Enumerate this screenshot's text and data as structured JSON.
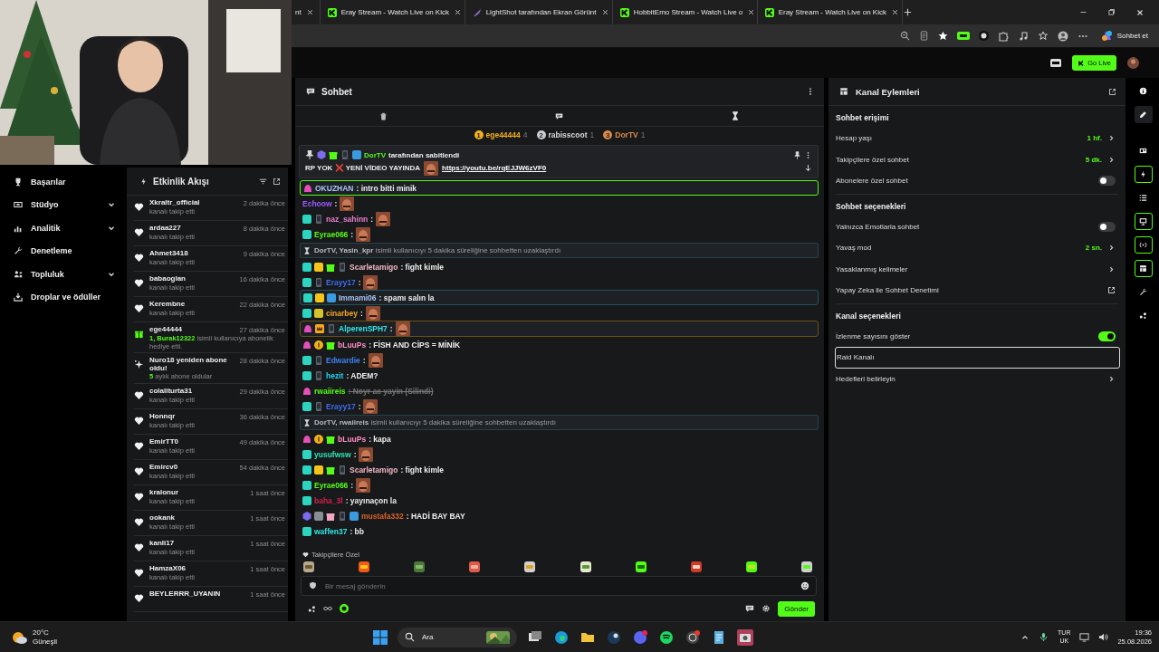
{
  "browser": {
    "tabs": [
      {
        "title": "nt"
      },
      {
        "title": "Eray Stream - Watch Live on Kick"
      },
      {
        "title": "LightShot tarafından Ekran Görünt"
      },
      {
        "title": "HobbitEmo Stream - Watch Live o"
      },
      {
        "title": "Eray Stream - Watch Live on Kick"
      }
    ],
    "copilot_label": "Sohbet et"
  },
  "header": {
    "go_live": "Go Live"
  },
  "sidebar": {
    "items": [
      {
        "label": "Başarılar",
        "expandable": false
      },
      {
        "label": "Stüdyo",
        "expandable": true
      },
      {
        "label": "Analitik",
        "expandable": true
      },
      {
        "label": "Denetleme",
        "expandable": false
      },
      {
        "label": "Topluluk",
        "expandable": true
      },
      {
        "label": "Droplar ve ödüller",
        "expandable": false
      }
    ]
  },
  "activity_feed": {
    "title": "Etkinlik Akışı",
    "items": [
      {
        "kind": "follow",
        "user": "Xkraltr_official",
        "time": "2 dakika önce",
        "detail": "kanalı takip etti"
      },
      {
        "kind": "follow",
        "user": "ardaa227",
        "time": "8 dakika önce",
        "detail": "kanalı takip etti"
      },
      {
        "kind": "follow",
        "user": "Ahmet3418",
        "time": "9 dakika önce",
        "detail": "kanalı takip etti"
      },
      {
        "kind": "follow",
        "user": "babaoglan",
        "time": "16 dakika önce",
        "detail": "kanalı takip etti"
      },
      {
        "kind": "follow",
        "user": "Kerembne",
        "time": "22 dakika önce",
        "detail": "kanalı takip etti"
      },
      {
        "kind": "gift",
        "user": "ege44444",
        "time": "27 dakika önce",
        "detail": "**1, Burak12322** isimli kullanıcıya abonelik hediye etti."
      },
      {
        "kind": "resub",
        "user": "Nuro18 yeniden abone oldu!",
        "time": "28 dakika önce",
        "detail": "**5** aylık abone oldular"
      },
      {
        "kind": "follow",
        "user": "colaliturta31",
        "time": "29 dakika önce",
        "detail": "kanalı takip etti"
      },
      {
        "kind": "follow",
        "user": "Honnqr",
        "time": "36 dakika önce",
        "detail": "kanalı takip etti"
      },
      {
        "kind": "follow",
        "user": "EmirTT0",
        "time": "49 dakika önce",
        "detail": "kanalı takip etti"
      },
      {
        "kind": "follow",
        "user": "Emircv0",
        "time": "54 dakika önce",
        "detail": "kanalı takip etti"
      },
      {
        "kind": "follow",
        "user": "kralonur",
        "time": "1 saat önce",
        "detail": "kanalı takip etti"
      },
      {
        "kind": "follow",
        "user": "ookank",
        "time": "1 saat önce",
        "detail": "kanalı takip etti"
      },
      {
        "kind": "follow",
        "user": "kanli17",
        "time": "1 saat önce",
        "detail": "kanalı takip etti"
      },
      {
        "kind": "follow",
        "user": "HamzaX06",
        "time": "1 saat önce",
        "detail": "kanalı takip etti"
      },
      {
        "kind": "follow",
        "user": "BEYLERRR_UYANIN",
        "time": "1 saat önce"
      }
    ]
  },
  "chat": {
    "title": "Sohbet",
    "leaderboard": [
      {
        "rank": "1",
        "user": "ege44444",
        "count": "4"
      },
      {
        "rank": "2",
        "user": "rabisscoot",
        "count": "1"
      },
      {
        "rank": "3",
        "user": "DorTV",
        "count": "1"
      }
    ],
    "pinned": {
      "badges": [
        {
          "kind": "pin"
        },
        {
          "kind": "purple"
        },
        {
          "kind": "gift"
        },
        {
          "kind": "phone"
        },
        {
          "kind": "mod"
        }
      ],
      "user": "DorTV",
      "note": "tarafından sabitlendi",
      "text": "RP YOK ❌ YENİ VİDEO YAYINDA",
      "link": "https://youtu.be/rqEJJW6zVF0"
    },
    "messages": [
      {
        "kind": "chat",
        "badges": [
          {
            "kind": "og"
          }
        ],
        "user": "OKUZHAN",
        "color": "#a9c4f5",
        "text": ": intro bitti minik",
        "emote": false,
        "highlight": {
          "color": "#53fc18"
        },
        "deleted": false
      },
      {
        "kind": "chat",
        "user": "Echoow",
        "color": "#9b5cff",
        "text": ":",
        "emote": true,
        "deleted": false
      },
      {
        "kind": "chat",
        "badges": [
          {
            "kind": "sub"
          },
          {
            "kind": "phone"
          }
        ],
        "user": "naz_sahinn",
        "color": "#e87fcf",
        "text": ":",
        "emote": true,
        "deleted": false
      },
      {
        "kind": "chat",
        "badges": [
          {
            "kind": "sub"
          }
        ],
        "user": "Eyrae066",
        "color": "#53fc18",
        "text": ":",
        "emote": true,
        "deleted": false
      },
      {
        "kind": "system",
        "text": "**DorTV, Yasin_kpr** isimli kullanıcıyı 5 dakika süreliğine sohbetten uzaklaştırdı"
      },
      {
        "kind": "chat",
        "badges": [
          {
            "kind": "sub"
          },
          {
            "kind": "kick"
          },
          {
            "kind": "gift"
          },
          {
            "kind": "phone"
          }
        ],
        "user": "Scarletamigo",
        "color": "#f2b8c6",
        "text": ": fight kimle",
        "emote": false,
        "deleted": false
      },
      {
        "kind": "chat",
        "badges": [
          {
            "kind": "sub"
          },
          {
            "kind": "phone"
          }
        ],
        "user": "Erayy17",
        "color": "#3d6df2",
        "text": ":",
        "emote": true,
        "deleted": false
      },
      {
        "kind": "chat",
        "badges": [
          {
            "kind": "sub"
          },
          {
            "kind": "kick"
          },
          {
            "kind": "mod"
          }
        ],
        "user": "Immami06",
        "color": "#a9c4f5",
        "text": ": spamı salın la",
        "emote": false,
        "highlight": {
          "color": "#1f5560"
        },
        "deleted": false
      },
      {
        "kind": "chat",
        "badges": [
          {
            "kind": "sub"
          },
          {
            "kind": "gem"
          }
        ],
        "user": "cinarbey",
        "color": "#f5a623",
        "text": ":",
        "emote": true,
        "deleted": false
      },
      {
        "kind": "chat",
        "badges": [
          {
            "kind": "og"
          },
          {
            "kind": "crown"
          },
          {
            "kind": "phone"
          }
        ],
        "user": "AlperenSPH7",
        "color": "#2ee6e6",
        "text": ":",
        "emote": true,
        "highlight": {
          "color": "#6b5014"
        },
        "deleted": false
      },
      {
        "kind": "chat",
        "badges": [
          {
            "kind": "og"
          },
          {
            "kind": "coin"
          },
          {
            "kind": "gift"
          }
        ],
        "user": "bLuuPs",
        "color": "#ff8fc4",
        "text": ": FİSH AND CİPS = MİNİK",
        "emote": false,
        "deleted": false
      },
      {
        "kind": "chat",
        "badges": [
          {
            "kind": "sub"
          },
          {
            "kind": "phone"
          }
        ],
        "user": "Edwardie",
        "color": "#3b82f6",
        "text": ":",
        "emote": true,
        "deleted": false
      },
      {
        "kind": "chat",
        "badges": [
          {
            "kind": "sub"
          },
          {
            "kind": "phone"
          }
        ],
        "user": "hezit",
        "color": "#22d3ee",
        "text": ": ADEM?",
        "emote": false,
        "deleted": false
      },
      {
        "kind": "chat",
        "badges": [
          {
            "kind": "og"
          }
        ],
        "user": "rwaiireis",
        "color": "#53fc18",
        "text": ": Noyr ac yayin (Silindi)",
        "emote": false,
        "deleted": true
      },
      {
        "kind": "chat",
        "badges": [
          {
            "kind": "sub"
          },
          {
            "kind": "phone"
          }
        ],
        "user": "Erayy17",
        "color": "#3d6df2",
        "text": ":",
        "emote": true,
        "deleted": false
      },
      {
        "kind": "system",
        "text": "**DorTV, rwaiireis** isimli kullanıcıyı 5 dakika süreliğine sohbetten uzaklaştırdı"
      },
      {
        "kind": "chat",
        "badges": [
          {
            "kind": "og"
          },
          {
            "kind": "coin"
          },
          {
            "kind": "gift"
          }
        ],
        "user": "bLuuPs",
        "color": "#ff8fc4",
        "text": ": kapa",
        "emote": false,
        "deleted": false
      },
      {
        "kind": "chat",
        "badges": [
          {
            "kind": "sub"
          }
        ],
        "user": "yusufwsw",
        "color": "#2ee6b0",
        "text": ":",
        "emote": true,
        "deleted": false
      },
      {
        "kind": "chat",
        "badges": [
          {
            "kind": "sub"
          },
          {
            "kind": "kick"
          },
          {
            "kind": "gift"
          },
          {
            "kind": "phone"
          }
        ],
        "user": "Scarletamigo",
        "color": "#f2b8c6",
        "text": ": fight kimle",
        "emote": false,
        "deleted": false
      },
      {
        "kind": "chat",
        "badges": [
          {
            "kind": "sub"
          }
        ],
        "user": "Eyrae066",
        "color": "#53fc18",
        "text": ":",
        "emote": true,
        "deleted": false
      },
      {
        "kind": "chat",
        "badges": [
          {
            "kind": "sub"
          }
        ],
        "user": "baha_3l",
        "color": "#d61f4b",
        "text": ": yayınaçon la",
        "emote": false,
        "deleted": false
      },
      {
        "kind": "chat",
        "badges": [
          {
            "kind": "purple"
          },
          {
            "kind": "sword"
          },
          {
            "kind": "pinkgift"
          },
          {
            "kind": "phone"
          },
          {
            "kind": "mod"
          }
        ],
        "user": "mustafa332",
        "color": "#d9632a",
        "text": ": HADİ BAY BAY",
        "emote": false,
        "deleted": false
      },
      {
        "kind": "chat",
        "badges": [
          {
            "kind": "sub"
          }
        ],
        "user": "waffen37",
        "color": "#2ee6e6",
        "text": ": bb",
        "emote": false,
        "deleted": false
      }
    ],
    "emote_section": "Takipçilere Özel",
    "input_placeholder": "Bir mesaj gönderin",
    "send": "Gönder"
  },
  "channel_actions": {
    "title": "Kanal Eylemleri",
    "sections": [
      {
        "title": "Sohbet erişimi",
        "rows": [
          {
            "kind": "value",
            "label": "Hesap yaşı",
            "value": "1 hf."
          },
          {
            "kind": "value",
            "label": "Takipçilere özel sohbet",
            "value": "5 dk."
          },
          {
            "kind": "toggle",
            "label": "Abonelere özel sohbet",
            "on": false
          }
        ]
      },
      {
        "title": "Sohbet seçenekleri",
        "rows": [
          {
            "kind": "toggle",
            "label": "Yalnızca Emotlarla sohbet",
            "on": false
          },
          {
            "kind": "value",
            "label": "Yavaş mod",
            "value": "2 sn."
          },
          {
            "kind": "link",
            "label": "Yasaklanmış kelimeler"
          },
          {
            "kind": "external",
            "label": "Yapay Zeka ile Sohbet Denetimi"
          }
        ]
      },
      {
        "title": "Kanal seçenekleri",
        "rows": [
          {
            "kind": "toggle",
            "label": "İzlenme sayısını göster",
            "on": true
          },
          {
            "kind": "outlined",
            "label": "Raid Kanalı"
          },
          {
            "kind": "link",
            "label": "Hedefleri belirleyin"
          }
        ]
      }
    ]
  },
  "rail": [
    {
      "kind": "info",
      "active": false,
      "selected": false
    },
    {
      "kind": "edit",
      "active": false,
      "selected": true
    },
    {
      "kind": "panel",
      "active": false,
      "selected": false
    },
    {
      "kind": "bolt",
      "active": true,
      "selected": false
    },
    {
      "kind": "list",
      "active": false,
      "selected": false
    },
    {
      "kind": "monitor",
      "active": true,
      "selected": false
    },
    {
      "kind": "broadcast",
      "active": true,
      "selected": false
    },
    {
      "kind": "layout",
      "active": true,
      "selected": false
    },
    {
      "kind": "wrench",
      "active": false,
      "selected": false
    },
    {
      "kind": "nodes",
      "active": false,
      "selected": false
    }
  ],
  "taskbar": {
    "weather_temp": "20°C",
    "weather_text": "Güneşli",
    "search": "Ara",
    "lang_top": "TUR",
    "lang_bottom": "UK",
    "time": "19:36",
    "date": "25.08.2026"
  }
}
